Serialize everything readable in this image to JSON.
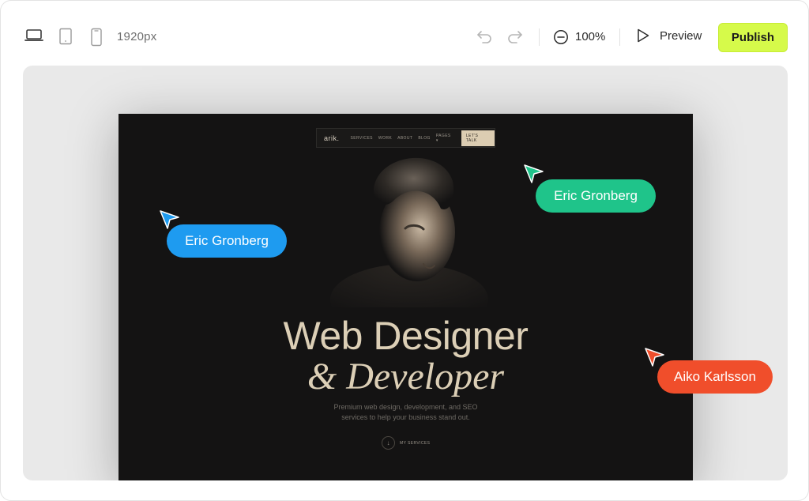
{
  "toolbar": {
    "width_label": "1920px",
    "zoom_label": "100%",
    "preview_label": "Preview",
    "publish_label": "Publish",
    "device_icons": [
      "laptop-icon",
      "tablet-icon",
      "phone-icon"
    ],
    "accent_color": "#d6fa4a"
  },
  "site": {
    "logo": "arik.",
    "nav": [
      "SERVICES",
      "WORK",
      "ABOUT",
      "BLOG",
      "PAGES ▾"
    ],
    "cta": "LET'S TALK",
    "hero_title": "Web Designer",
    "hero_subtitle": "& Developer",
    "hero_desc_line1": "Premium web design, development, and SEO",
    "hero_desc_line2": "services to help your business stand out.",
    "services_link": "MY SERVICES"
  },
  "collaborators": [
    {
      "name": "Eric Gronberg",
      "color": "#1e9bf0"
    },
    {
      "name": "Eric Gronberg",
      "color": "#1fc48a"
    },
    {
      "name": "Aiko Karlsson",
      "color": "#f04e2b"
    }
  ]
}
